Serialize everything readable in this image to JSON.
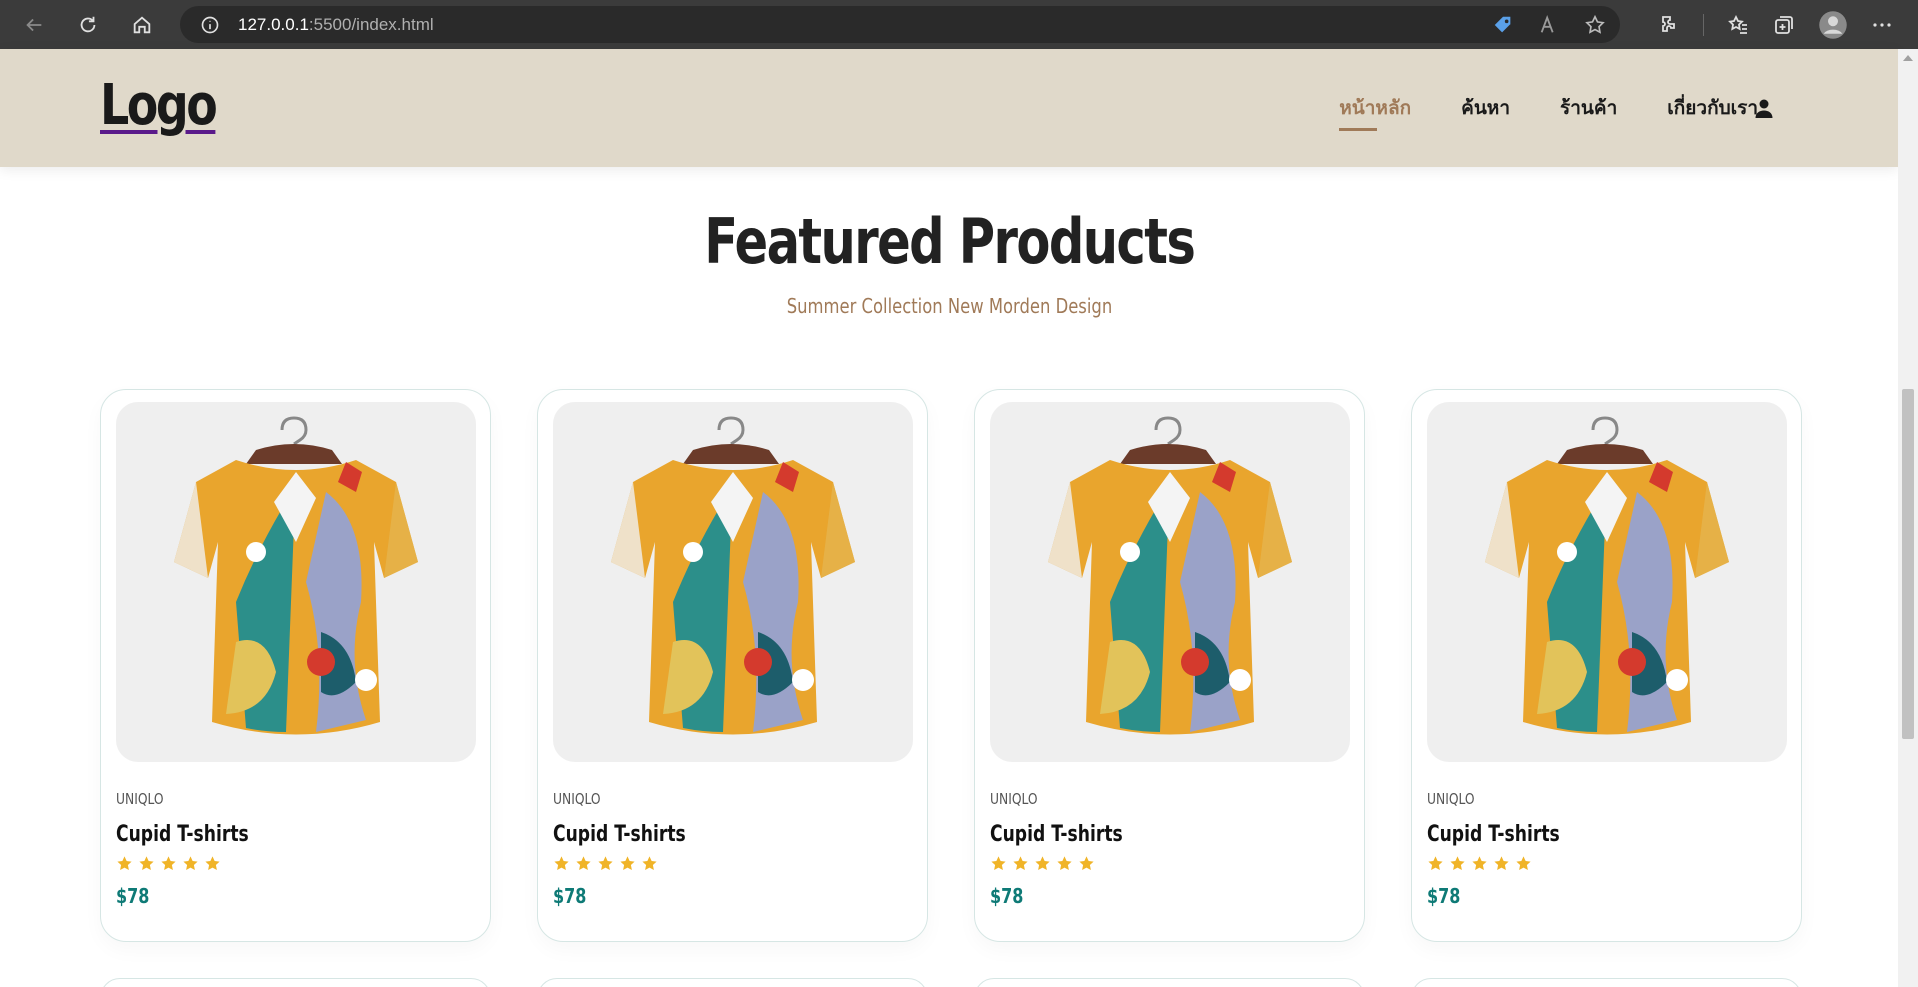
{
  "browser": {
    "url_host": "127.0.0.1",
    "url_path": ":5500/index.html"
  },
  "site": {
    "logo": "Logo",
    "nav": [
      {
        "label": "หน้าหลัก",
        "active": true
      },
      {
        "label": "ค้นหา",
        "active": false
      },
      {
        "label": "ร้านค้า",
        "active": false
      },
      {
        "label": "เกี่ยวกับเรา",
        "active": false
      }
    ]
  },
  "featured": {
    "title": "Featured Products",
    "subtitle": "Summer Collection New Morden Design",
    "products": [
      {
        "brand": "UNIQLO",
        "name": "Cupid T-shirts",
        "rating": 5,
        "price": "$78"
      },
      {
        "brand": "UNIQLO",
        "name": "Cupid T-shirts",
        "rating": 5,
        "price": "$78"
      },
      {
        "brand": "UNIQLO",
        "name": "Cupid T-shirts",
        "rating": 5,
        "price": "$78"
      },
      {
        "brand": "UNIQLO",
        "name": "Cupid T-shirts",
        "rating": 5,
        "price": "$78"
      }
    ]
  },
  "colors": {
    "header_bg": "#e0d9ca",
    "accent": "#a07a58",
    "price": "#0e7a76",
    "star": "#f0b428"
  },
  "icons": [
    "back-icon",
    "reload-icon",
    "home-icon",
    "info-icon",
    "tag-icon",
    "read-aloud-icon",
    "favorite-add-icon",
    "extensions-icon",
    "favorites-icon",
    "collections-icon",
    "profile-icon",
    "more-icon",
    "user-icon",
    "star-icon"
  ]
}
